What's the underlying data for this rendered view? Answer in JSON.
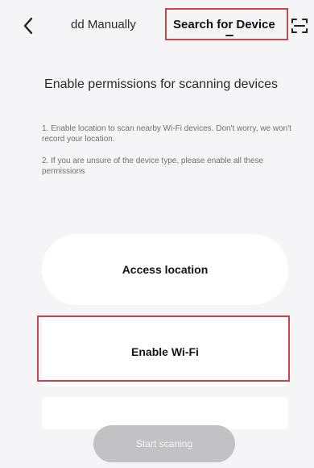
{
  "header": {
    "back_icon": "chevron-left-icon",
    "tabs": [
      {
        "label": "dd Manually",
        "selected": false
      },
      {
        "label": "Search for Device",
        "selected": true
      }
    ],
    "scan_icon": "scan-frame-icon"
  },
  "main": {
    "heading": "Enable permissions for scanning devices",
    "notes": [
      "1. Enable location to scan nearby Wi-Fi devices. Don't worry, we won't record your location.",
      "2. If you are unsure of the device type, please enable all these permissions"
    ],
    "permissions": [
      {
        "label": "Access location"
      },
      {
        "label": "Enable Wi-Fi"
      }
    ],
    "start_button": "Start scaning"
  },
  "colors": {
    "highlight": "#c9454c",
    "background": "#f5f5f7",
    "card": "#ffffff",
    "button_disabled": "#c2c2c4"
  }
}
